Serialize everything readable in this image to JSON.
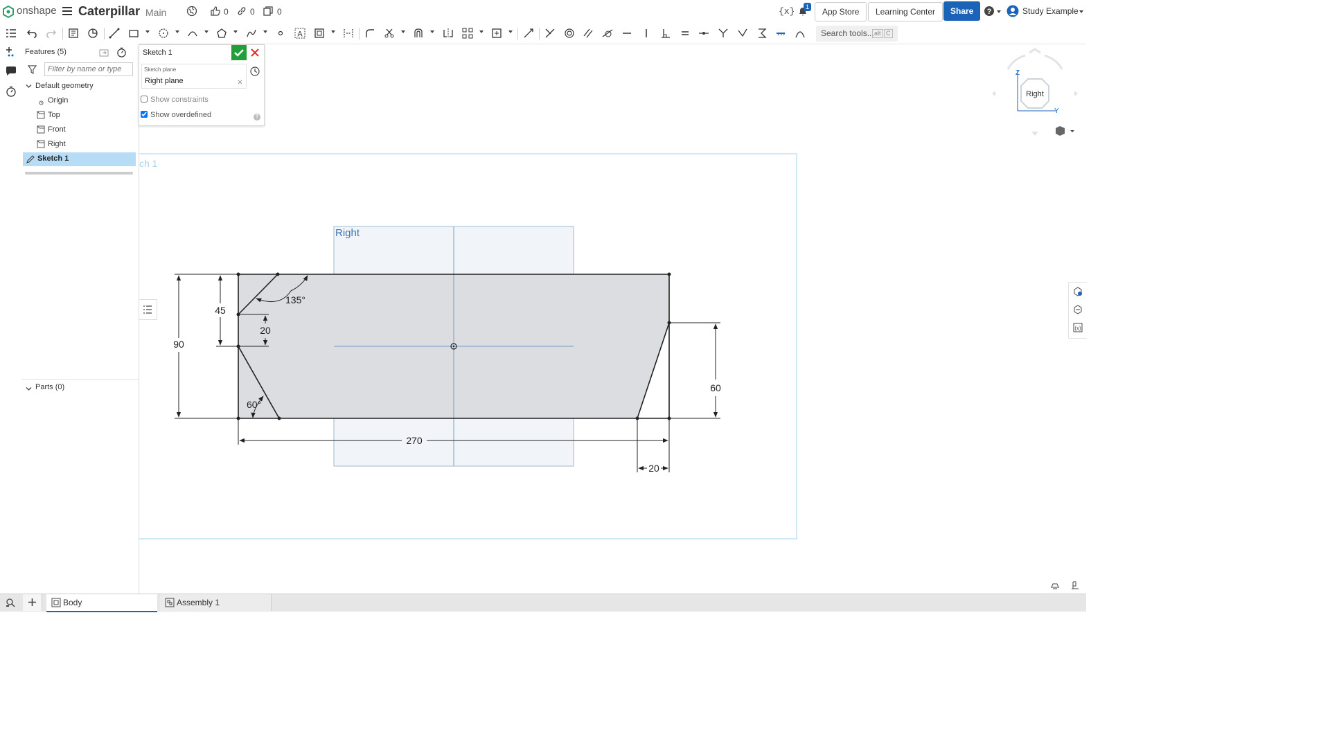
{
  "app": {
    "logo": "onshape",
    "document_title": "Caterpillar",
    "workspace": "Main",
    "likes": "0",
    "links": "0",
    "copies": "0"
  },
  "topbar": {
    "variables_label": "{x}",
    "notification_count": "1",
    "app_store": "App Store",
    "learning_center": "Learning Center",
    "share": "Share",
    "user": "Study Example"
  },
  "toolbar": {
    "search_placeholder": "Search tools...",
    "shortcut_alt": "alt",
    "shortcut_key": "C"
  },
  "features": {
    "header": "Features (5)",
    "filter_placeholder": "Filter by name or type",
    "group": "Default geometry",
    "items": [
      "Origin",
      "Top",
      "Front",
      "Right"
    ],
    "selected": "Sketch 1",
    "parts_header": "Parts (0)"
  },
  "sketch_dialog": {
    "title": "Sketch 1",
    "plane_label": "Sketch plane",
    "plane_value": "Right plane",
    "show_constraints": "Show constraints",
    "show_constraints_checked": false,
    "show_overdefined": "Show overdefined",
    "show_overdefined_checked": true,
    "help": "?"
  },
  "viewport": {
    "sketch_watermark": "ch 1",
    "plane_label": "Right",
    "dimensions": {
      "width": "270",
      "height": "90",
      "left_top": "45",
      "left_inner": "20",
      "angle_top": "135°",
      "angle_bottom": "60°",
      "right_height": "60",
      "right_bottom": "20"
    }
  },
  "view_cube": {
    "face": "Right",
    "axis_z": "Z",
    "axis_y": "Y"
  },
  "bottom_tabs": [
    {
      "label": "Body",
      "active": true
    },
    {
      "label": "Assembly 1",
      "active": false
    }
  ]
}
